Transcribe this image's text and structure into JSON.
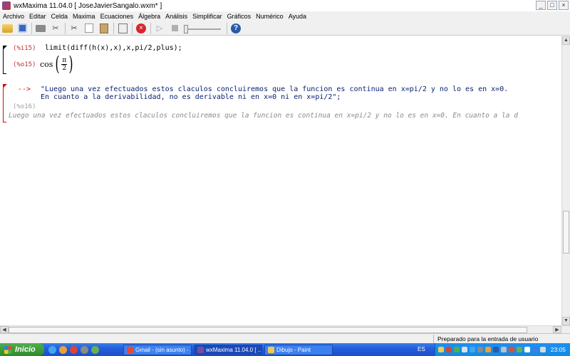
{
  "window": {
    "title": "wxMaxima 11.04.0  [ JoseJavierSangalo.wxm* ]",
    "buttons": {
      "minimize": "_",
      "maximize": "□",
      "close": "×"
    }
  },
  "menu": [
    "Archivo",
    "Editar",
    "Celda",
    "Maxima",
    "Ecuaciones",
    "Álgebra",
    "Análisis",
    "Simplificar",
    "Gráficos",
    "Numérico",
    "Ayuda"
  ],
  "toolbar": {
    "icons": [
      "open-icon",
      "save-icon",
      "print-icon",
      "config-icon",
      "cut-icon",
      "copy-icon",
      "paste-icon",
      "find-icon",
      "interrupt-icon",
      "play-icon",
      "stop-icon",
      "slider",
      "help-icon"
    ],
    "interrupt_glyph": "×",
    "play_glyph": "▷",
    "help_glyph": "?",
    "tools_glyph": "✂",
    "cut_glyph": "✂"
  },
  "cells": {
    "input1": {
      "label": "(%i15)",
      "code": "limit(diff(h(x),x),x,pi/2,plus);"
    },
    "output1": {
      "label": "(%o15)",
      "fn": "cos",
      "paren_open": "(",
      "paren_close": ")",
      "numerator": "π",
      "denominator": "2"
    },
    "input2": {
      "arrow": "-->",
      "line1": "\"Luego una vez efectuados estos claculos concluiremos que la funcion es continua en x=pi/2 y no lo es en x=0.",
      "line2": "En cuanto a la derivabilidad, no es derivable ni en x=0 ni en x=pi/2\";"
    },
    "output2": {
      "label": "(%o16)",
      "text": "Luego una vez efectuados estos claculos concluiremos que la funcion es continua en x=pi/2 y no lo es en x=0. En cuanto a la d"
    }
  },
  "statusbar": {
    "text": "Preparado para la entrada de usuario"
  },
  "taskbar": {
    "start": "Inicio",
    "tasks": [
      {
        "label": "Gmail - (sin asunto) - ...",
        "active": false
      },
      {
        "label": "wxMaxima 11.04.0  [ ...",
        "active": true
      },
      {
        "label": "Dibujo - Paint",
        "active": false
      }
    ],
    "language": "ES",
    "clock": "23:05"
  },
  "colors": {
    "prompt_red": "#d01010",
    "label_red": "#c03030",
    "text_blue": "#0a2070",
    "output_grey": "#8a8a8a",
    "taskbar_blue": "#245edb",
    "start_green": "#2e8a2a"
  }
}
